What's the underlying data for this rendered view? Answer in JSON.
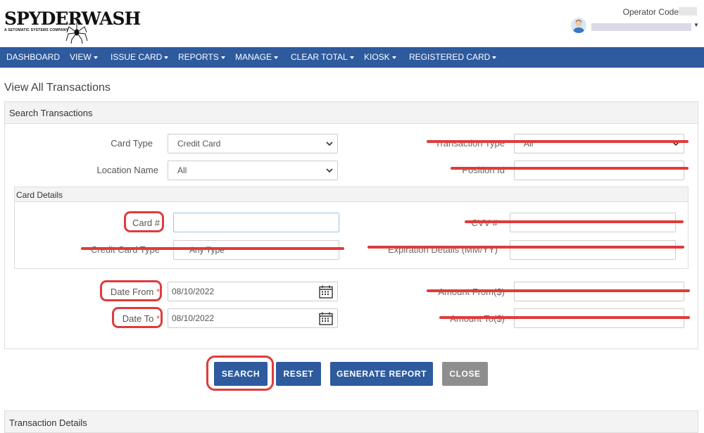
{
  "header": {
    "logo_text": "SPYDERWASH",
    "logo_subtitle": "A SETOMATIC SYSTEMS COMPANY",
    "operator_label": "Operator Code"
  },
  "nav": {
    "items": [
      {
        "label": "DASHBOARD",
        "dropdown": false
      },
      {
        "label": "VIEW",
        "dropdown": true
      },
      {
        "label": "ISSUE CARD",
        "dropdown": true
      },
      {
        "label": "REPORTS",
        "dropdown": true
      },
      {
        "label": "MANAGE",
        "dropdown": true
      },
      {
        "label": "CLEAR TOTAL",
        "dropdown": true
      },
      {
        "label": "KIOSK",
        "dropdown": true
      },
      {
        "label": "REGISTERED CARD",
        "dropdown": true
      }
    ]
  },
  "page": {
    "title": "View All Transactions"
  },
  "search_panel": {
    "title": "Search Transactions",
    "card_type": {
      "label": "Card Type",
      "value": "Credit Card"
    },
    "location_name": {
      "label": "Location Name",
      "value": "All"
    },
    "transaction_type": {
      "label": "Transaction Type",
      "value": "All"
    },
    "position_id": {
      "label": "Position Id",
      "value": ""
    },
    "card_details": {
      "title": "Card Details",
      "card_number": {
        "label": "Card #",
        "value": ""
      },
      "cvv": {
        "label": "CVV #",
        "value": ""
      },
      "credit_card_type": {
        "label": "Credit Card Type",
        "value": "Any Type"
      },
      "expiration": {
        "label": "Expiration Details (MM/YY)",
        "value": ""
      }
    },
    "date_from": {
      "label": "Date From",
      "required_mark": "*",
      "value": "08/10/2022"
    },
    "date_to": {
      "label": "Date To",
      "required_mark": "*",
      "value": "08/10/2022"
    },
    "amount_from": {
      "label": "Amount From($)",
      "value": ""
    },
    "amount_to": {
      "label": "Amount To($)",
      "value": ""
    }
  },
  "buttons": {
    "search": "SEARCH",
    "reset": "RESET",
    "generate_report": "GENERATE REPORT",
    "close": "CLOSE"
  },
  "transaction_panel": {
    "title": "Transaction Details"
  },
  "colors": {
    "nav_bg": "#2e5a9e",
    "primary_button": "#2e5a9e",
    "close_button": "#8e8e8e",
    "annotation_red": "#e03b3b",
    "required_star": "#d9534f"
  }
}
